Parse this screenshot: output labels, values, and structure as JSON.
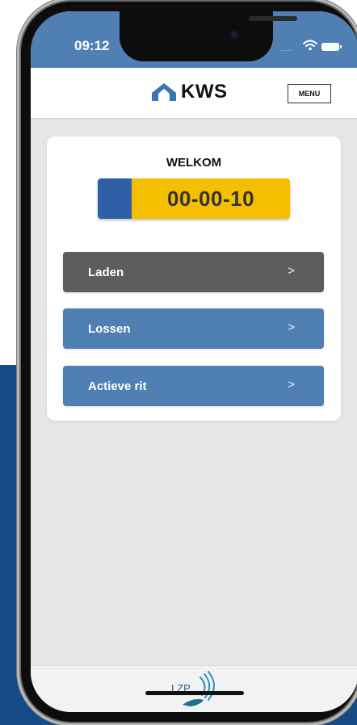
{
  "status_bar": {
    "time": "09:12",
    "signal_dots": "....",
    "wifi_icon": "wifi-icon",
    "battery_icon": "battery-icon"
  },
  "header": {
    "logo_text": "KWS",
    "logo_icon": "kws-house-icon",
    "menu_label": "MENU"
  },
  "main": {
    "welcome": "WELKOM",
    "plate_number": "00-00-10",
    "buttons": [
      {
        "label": "Laden",
        "chevron": ">",
        "color": "#5d5d5d"
      },
      {
        "label": "Lossen",
        "chevron": ">",
        "color": "#4f7fb3"
      },
      {
        "label": "Actieve rit",
        "chevron": ">",
        "color": "#4f7fb3"
      }
    ]
  },
  "footer": {
    "logo_text": "LZP"
  },
  "colors": {
    "accent": "#4f7fb3",
    "plate_yellow": "#f3bf00",
    "plate_blue": "#2f5fa7",
    "background_blue": "#144a86"
  }
}
